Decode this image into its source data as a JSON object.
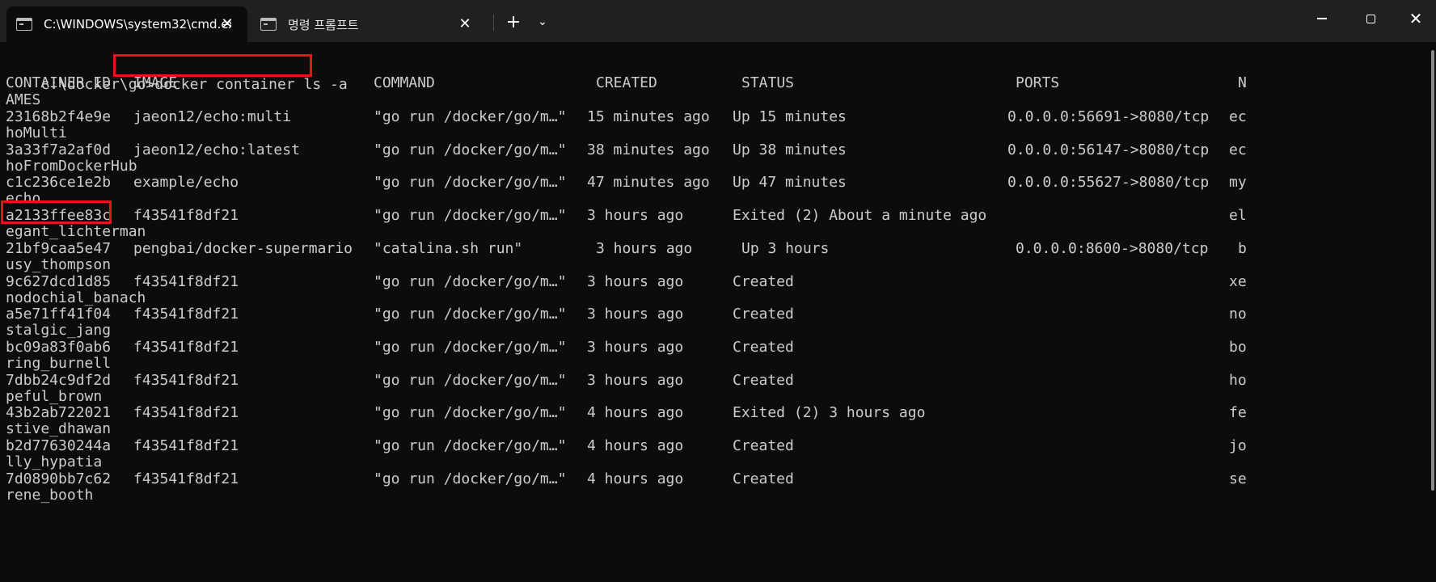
{
  "window": {
    "tabs": [
      {
        "title": "C:\\WINDOWS\\system32\\cmd.exe",
        "active": true
      },
      {
        "title": "명령 프롬프트",
        "active": false
      }
    ],
    "new_tab_glyph": "+",
    "dropdown_glyph": "⌄",
    "close_glyph": "✕",
    "icons": [
      "terminal-icon",
      "close-icon",
      "plus-icon",
      "chevron-down-icon",
      "minimize-icon",
      "maximize-icon",
      "close-window-icon"
    ]
  },
  "terminal": {
    "prompt": "c:\\docker\\go>",
    "command": "docker container ls -a",
    "headers": {
      "container_id": "CONTAINER ID",
      "image": "IMAGE",
      "command": "COMMAND",
      "created": "CREATED",
      "status": "STATUS",
      "ports": "PORTS",
      "names_start": "N",
      "names_wrap": "AMES"
    },
    "rows": [
      {
        "id": "23168b2f4e9e",
        "image": "jaeon12/echo:multi",
        "command": "\"go run /docker/go/m…\"",
        "created": "15 minutes ago",
        "status": "Up 15 minutes",
        "ports": "0.0.0.0:56691->8080/tcp",
        "name_start": "ec",
        "name_wrap": "hoMulti"
      },
      {
        "id": "3a33f7a2af0d",
        "image": "jaeon12/echo:latest",
        "command": "\"go run /docker/go/m…\"",
        "created": "38 minutes ago",
        "status": "Up 38 minutes",
        "ports": "0.0.0.0:56147->8080/tcp",
        "name_start": "ec",
        "name_wrap": "hoFromDockerHub"
      },
      {
        "id": "c1c236ce1e2b",
        "image": "example/echo",
        "command": "\"go run /docker/go/m…\"",
        "created": "47 minutes ago",
        "status": "Up 47 minutes",
        "ports": "0.0.0.0:55627->8080/tcp",
        "name_start": "my",
        "name_wrap": "echo"
      },
      {
        "id": "a2133ffee83c",
        "image": "f43541f8df21",
        "command": "\"go run /docker/go/m…\"",
        "created": "3 hours ago",
        "status": "Exited (2) About a minute ago",
        "ports": "",
        "name_start": "el",
        "name_wrap": "egant_lichterman"
      },
      {
        "id": "21bf9caa5e47",
        "image": "pengbai/docker-supermario",
        "command": "\"catalina.sh run\"",
        "created": "3 hours ago",
        "status": "Up 3 hours",
        "ports": "0.0.0.0:8600->8080/tcp",
        "name_start": "b",
        "name_wrap": "usy_thompson"
      },
      {
        "id": "9c627dcd1d85",
        "image": "f43541f8df21",
        "command": "\"go run /docker/go/m…\"",
        "created": "3 hours ago",
        "status": "Created",
        "ports": "",
        "name_start": "xe",
        "name_wrap": "nodochial_banach"
      },
      {
        "id": "a5e71ff41f04",
        "image": "f43541f8df21",
        "command": "\"go run /docker/go/m…\"",
        "created": "3 hours ago",
        "status": "Created",
        "ports": "",
        "name_start": "no",
        "name_wrap": "stalgic_jang"
      },
      {
        "id": "bc09a83f0ab6",
        "image": "f43541f8df21",
        "command": "\"go run /docker/go/m…\"",
        "created": "3 hours ago",
        "status": "Created",
        "ports": "",
        "name_start": "bo",
        "name_wrap": "ring_burnell"
      },
      {
        "id": "7dbb24c9df2d",
        "image": "f43541f8df21",
        "command": "\"go run /docker/go/m…\"",
        "created": "3 hours ago",
        "status": "Created",
        "ports": "",
        "name_start": "ho",
        "name_wrap": "peful_brown"
      },
      {
        "id": "43b2ab722021",
        "image": "f43541f8df21",
        "command": "\"go run /docker/go/m…\"",
        "created": "4 hours ago",
        "status": "Exited (2) 3 hours ago",
        "ports": "",
        "name_start": "fe",
        "name_wrap": "stive_dhawan"
      },
      {
        "id": "b2d77630244a",
        "image": "f43541f8df21",
        "command": "\"go run /docker/go/m…\"",
        "created": "4 hours ago",
        "status": "Created",
        "ports": "",
        "name_start": "jo",
        "name_wrap": "lly_hypatia"
      },
      {
        "id": "7d0890bb7c62",
        "image": "f43541f8df21",
        "command": "\"go run /docker/go/m…\"",
        "created": "4 hours ago",
        "status": "Created",
        "ports": "",
        "name_start": "se",
        "name_wrap": "rene_booth"
      }
    ]
  },
  "colors": {
    "terminal_bg": "#0c0c0c",
    "text": "#cccccc",
    "titlebar_bg": "#202020",
    "highlight": "#e8141b"
  }
}
